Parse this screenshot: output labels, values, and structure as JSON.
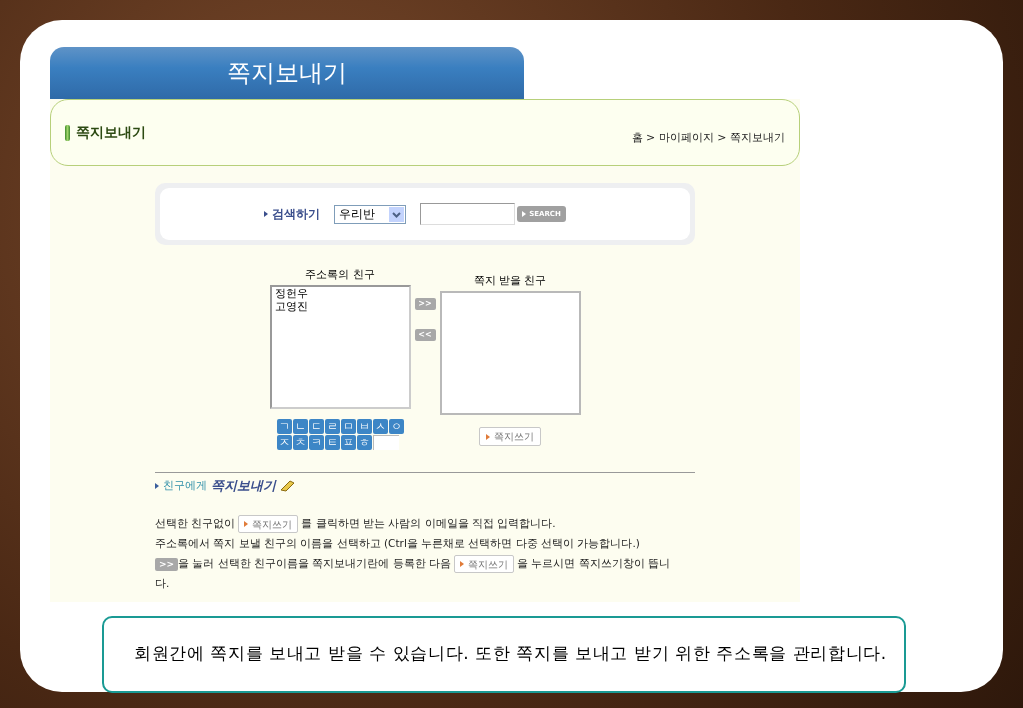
{
  "page_title": "쪽지보내기",
  "header": {
    "title": "쪽지보내기",
    "breadcrumb": "홈 > 마이페이지 > 쪽지보내기"
  },
  "search": {
    "label": "검색하기",
    "select_value": "우리반",
    "button": "SEARCH"
  },
  "address_book": {
    "title": "주소록의 친구",
    "items": [
      {
        "name": "정헌우",
        "selected": false
      },
      {
        "name": "고영진",
        "selected": false
      }
    ]
  },
  "move_buttons": [
    ">>",
    "<<"
  ],
  "recipients": {
    "title": "쪽지 받을 친구"
  },
  "consonants": [
    [
      "ㄱ",
      "ㄴ",
      "ㄷ",
      "ㄹ",
      "ㅁ",
      "ㅂ",
      "ㅅ",
      "ㅇ"
    ],
    [
      "ㅈ",
      "ㅊ",
      "ㅋ",
      "ㅌ",
      "ㅍ",
      "ㅎ"
    ]
  ],
  "write_button": "쪽지쓰기",
  "section": {
    "prefix": "친구에게",
    "title": "쪽지보내기"
  },
  "instructions": [
    [
      {
        "kind": "text",
        "text": "선택한 친구없이"
      },
      {
        "kind": "button",
        "text": "쪽지쓰기"
      },
      {
        "kind": "text",
        "text": "를 클릭하면 받는 사람의 이메일을 직접 입력합니다."
      }
    ],
    [
      {
        "kind": "text",
        "text": "주소록에서 쪽지 보낼 친구의 이름을 선택하고 (Ctrl을 누른채로 선택하면 다중 선택이 가능합니다.)"
      }
    ],
    [
      {
        "kind": "arrow",
        "text": ">>"
      },
      {
        "kind": "text",
        "text": "을 눌러 선택한 친구이름을 쪽지보내기란에 등록한 다음"
      },
      {
        "kind": "button",
        "text": "쪽지쓰기"
      },
      {
        "kind": "text",
        "text": "을 누르시면 쪽지쓰기창이 뜹니"
      }
    ],
    [
      {
        "kind": "text",
        "text": "다."
      }
    ]
  ],
  "caption": "회원간에 쪽지를 보내고 받을 수 있습니다. 또한 쪽지를 보내고 받기 위한 주소록을 관리합니다."
}
